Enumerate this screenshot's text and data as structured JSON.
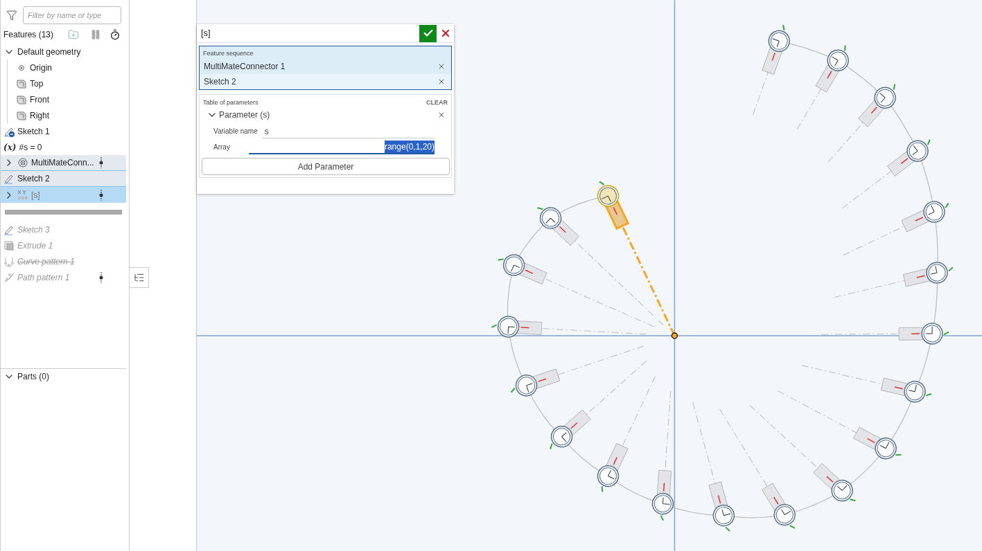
{
  "sidebar": {
    "filter": {
      "placeholder": "Filter by name or type"
    },
    "header": "Features (13)",
    "features": [
      {
        "label": "Default geometry",
        "kind": "group",
        "expanded": true,
        "children": [
          {
            "label": "Origin",
            "kind": "point"
          },
          {
            "label": "Top",
            "kind": "plane"
          },
          {
            "label": "Front",
            "kind": "plane"
          },
          {
            "label": "Right",
            "kind": "plane"
          }
        ]
      },
      {
        "label": "Sketch 1",
        "kind": "sketch-hidden",
        "selected": false,
        "in_sequence": false,
        "rolled_back": false,
        "suppressed": false,
        "marker": false
      },
      {
        "label": "#s = 0",
        "kind": "variable",
        "icon": "(x)",
        "selected": false,
        "in_sequence": false,
        "rolled_back": false,
        "suppressed": false,
        "marker": false
      },
      {
        "label": "MultiMateConn...",
        "kind": "connector",
        "expanded": false,
        "selected": false,
        "in_sequence": true,
        "rolled_back": false,
        "suppressed": false,
        "marker": true
      },
      {
        "label": "Sketch 2",
        "kind": "sketch",
        "selected": false,
        "in_sequence": true,
        "rolled_back": false,
        "suppressed": false,
        "marker": false
      },
      {
        "label": "[s]",
        "kind": "pattern",
        "expanded": false,
        "selected": true,
        "in_sequence": false,
        "rolled_back": false,
        "suppressed": false,
        "marker": true
      },
      {
        "label": "Sketch 3",
        "kind": "sketch",
        "selected": false,
        "in_sequence": false,
        "rolled_back": true,
        "suppressed": false,
        "marker": false
      },
      {
        "label": "Extrude 1",
        "kind": "extrude",
        "selected": false,
        "in_sequence": false,
        "rolled_back": true,
        "suppressed": false,
        "marker": false
      },
      {
        "label": "Curve pattern 1",
        "kind": "curve-pattern",
        "selected": false,
        "in_sequence": false,
        "rolled_back": true,
        "suppressed": true,
        "marker": false
      },
      {
        "label": "Path pattern 1",
        "kind": "path-pattern",
        "selected": false,
        "in_sequence": false,
        "rolled_back": true,
        "suppressed": false,
        "marker": true
      }
    ],
    "parts": {
      "label": "Parts (0)",
      "expanded": true
    }
  },
  "dialog": {
    "title": "[s]",
    "feature_sequence": {
      "label": "Feature sequence",
      "items": [
        "MultiMateConnector 1",
        "Sketch 2"
      ]
    },
    "parameters": {
      "label": "Table of parameters",
      "clear": "CLEAR",
      "items": [
        {
          "title": "Parameter (s)",
          "expanded": true,
          "fields": [
            {
              "label": "Variable name",
              "value": "s",
              "focused": false
            },
            {
              "label": "Array",
              "value": "range(0,1,20)",
              "focused": true
            }
          ]
        }
      ]
    },
    "add_button": "Add Parameter"
  }
}
